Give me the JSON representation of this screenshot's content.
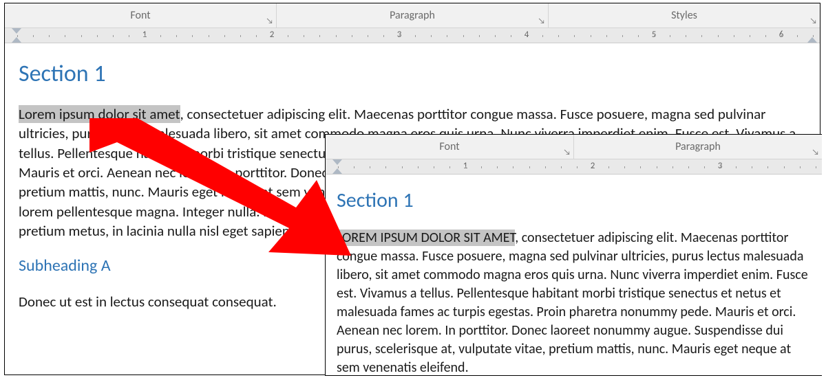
{
  "back": {
    "ribbon": {
      "font": "Font",
      "paragraph": "Paragraph",
      "styles": "Styles"
    },
    "ruler_numbers": [
      "1",
      "2",
      "3",
      "4",
      "5",
      "6"
    ],
    "heading1": "Section 1",
    "selected_text": "Lorem ipsum dolor sit amet",
    "para1_rest": ", consectetuer adipiscing elit. Maecenas porttitor congue massa. Fusce posuere, magna sed pulvinar ultricies, purus lectus malesuada libero, sit amet commodo magna eros quis urna. Nunc viverra imperdiet enim. Fusce est. Vivamus a tellus. Pellentesque habitant morbi tristique senectus et netus et malesuada fames ac turpis egestas. Proin pharetra nonummy pede. Mauris et orci. Aenean nec lorem. In porttitor. Donec laoreet nonummy augue. Suspendisse dui purus, scelerisque at, vulputate vitae, pretium mattis, nunc. Mauris eget neque at sem venenatis eleifend. Ut nonummy. Fusce aliquet pede non pede. Suspendisse dapibus lorem pellentesque magna. Integer nulla. Donec blandit feugiat ligula. Donec hendrerit, felis et imperdiet euismod, purus ipsum pretium metus, in lacinia nulla nisl eget sapien.",
    "heading2": "Subheading A",
    "para2": "Donec ut est in lectus consequat consequat."
  },
  "front": {
    "ribbon": {
      "font": "Font",
      "paragraph": "Paragraph"
    },
    "ruler_numbers": [
      "1",
      "2",
      "3"
    ],
    "heading1": "Section 1",
    "selected_text": "LOREM IPSUM DOLOR SIT AMET",
    "para1_rest": ", consectetuer adipiscing elit. Maecenas porttitor congue massa. Fusce posuere, magna sed pulvinar ultricies, purus lectus malesuada libero, sit amet commodo magna eros quis urna. Nunc viverra imperdiet enim. Fusce est. Vivamus a tellus. Pellentesque habitant morbi tristique senectus et netus et malesuada fames ac turpis egestas. Proin pharetra nonummy pede. Mauris et orci. Aenean nec lorem. In porttitor. Donec laoreet nonummy augue. Suspendisse dui purus, scelerisque at, vulputate vitae, pretium mattis, nunc. Mauris eget neque at sem venenatis eleifend."
  }
}
